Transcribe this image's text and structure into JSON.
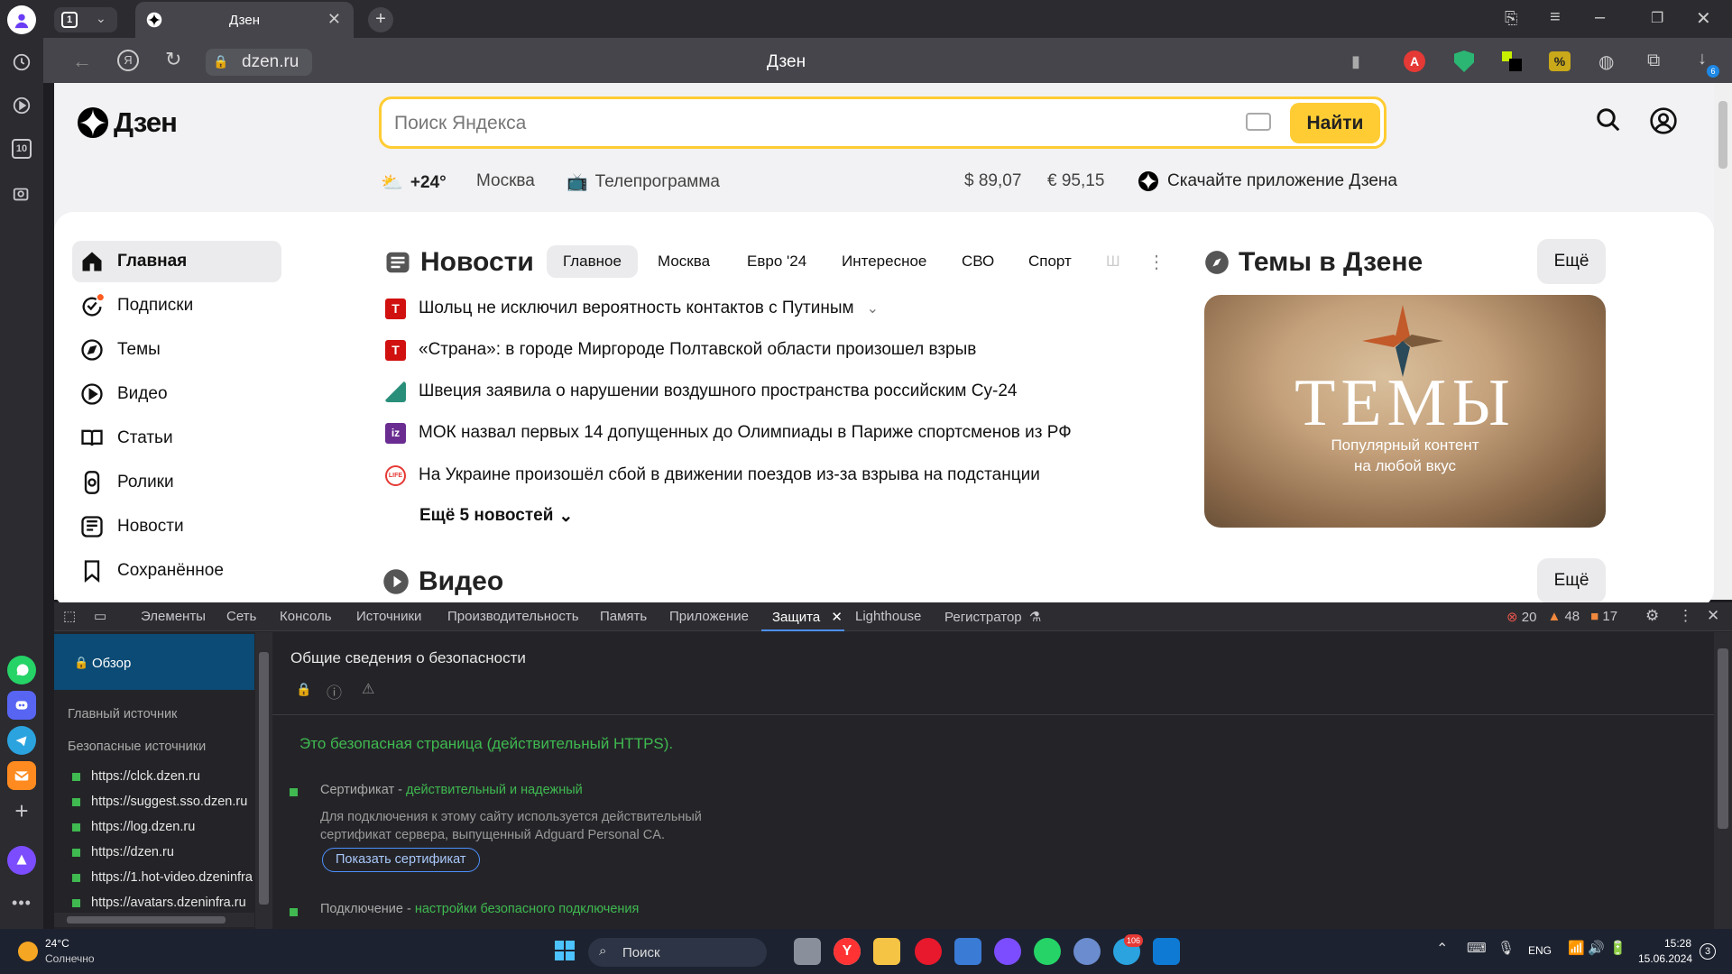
{
  "browser": {
    "tab_count": "1",
    "tab_title": "Дзен",
    "new_tab": "+",
    "url": "dzen.ru",
    "page_title": "Дзен",
    "downloads_badge": "6",
    "sidebar_badge": "10"
  },
  "dzen": {
    "logo_text": "Дзен",
    "search_placeholder": "Поиск Яндекса",
    "search_button": "Найти",
    "weather": "+24°",
    "city": "Москва",
    "tv": "Телепрограмма",
    "usd": "$ 89,07",
    "eur": "€ 95,15",
    "app": "Скачайте приложение Дзена",
    "nav": [
      {
        "label": "Главная"
      },
      {
        "label": "Подписки"
      },
      {
        "label": "Темы"
      },
      {
        "label": "Видео"
      },
      {
        "label": "Статьи"
      },
      {
        "label": "Ролики"
      },
      {
        "label": "Новости"
      },
      {
        "label": "Сохранённое"
      }
    ],
    "news_title": "Новости",
    "news_tabs": [
      "Главное",
      "Москва",
      "Евро '24",
      "Интересное",
      "СВО",
      "Спорт",
      "Ш"
    ],
    "news": [
      {
        "text": "Шольц не исключил вероятность контактов с Путиным",
        "src": "Т",
        "color": "#d11010"
      },
      {
        "text": "«Страна»: в городе Миргороде Полтавской области произошел взрыв",
        "src": "Т",
        "color": "#d11010"
      },
      {
        "text": "Швеция заявила о нарушении воздушного пространства российским Су-24",
        "src": "",
        "color": "#2a8f7a"
      },
      {
        "text": "МОК назвал первых 14 допущенных до Олимпиады в Париже спортсменов из РФ",
        "src": "iz",
        "color": "#6a2c91"
      },
      {
        "text": "На Украине произошёл сбой в движении поездов из-за взрыва на подстанции",
        "src": "LIFE",
        "color": "#e53935"
      }
    ],
    "more_news": "Ещё 5 новостей",
    "topics_title": "Темы в Дзене",
    "more": "Ещё",
    "topics_banner_title": "ТЕМЫ",
    "topics_banner_sub1": "Популярный контент",
    "topics_banner_sub2": "на любой вкус",
    "video_title": "Видео"
  },
  "devtools": {
    "tabs": [
      "Элементы",
      "Сеть",
      "Консоль",
      "Источники",
      "Производительность",
      "Память",
      "Приложение",
      "Защита",
      "Lighthouse",
      "Регистратор"
    ],
    "active_tab": "Защита",
    "errors": "20",
    "warnings": "48",
    "issues": "17",
    "overview": "Обзор",
    "main_origin": "Главный источник",
    "secure_origins": "Безопасные источники",
    "origins": [
      "https://clck.dzen.ru",
      "https://suggest.sso.dzen.ru",
      "https://log.dzen.ru",
      "https://dzen.ru",
      "https://1.hot-video.dzeninfra",
      "https://avatars.dzeninfra.ru"
    ],
    "security_title": "Общие сведения о безопасности",
    "secure_msg": "Это безопасная страница (действительный HTTPS).",
    "cert_label": "Сертификат - ",
    "cert_status": "действительный и надежный",
    "cert_desc1": "Для подключения к этому сайту используется действительный",
    "cert_desc2": "сертификат сервера, выпущенный Adguard Personal CA.",
    "show_cert": "Показать сертификат",
    "conn_label": "Подключение - ",
    "conn_status": "настройки безопасного подключения"
  },
  "taskbar": {
    "temp": "24°C",
    "weather": "Солнечно",
    "search": "Поиск",
    "lang": "ENG",
    "time": "15:28",
    "date": "15.06.2024",
    "notif": "3",
    "badge": "106"
  }
}
